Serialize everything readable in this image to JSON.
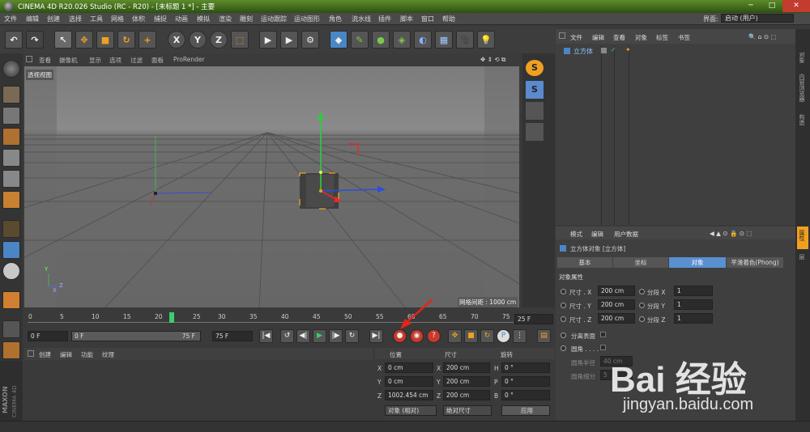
{
  "window": {
    "title": "CINEMA 4D R20.026 Studio (RC - R20) - [未标题 1 *] - 主要",
    "minimize": "─",
    "maximize": "□",
    "close": "✕"
  },
  "menu": [
    "文件",
    "编辑",
    "创建",
    "选择",
    "工具",
    "网格",
    "体积",
    "捕捉",
    "动画",
    "模拟",
    "渲染",
    "雕刻",
    "运动跟踪",
    "运动图形",
    "角色",
    "流水线",
    "插件",
    "脚本",
    "窗口",
    "帮助"
  ],
  "layout": {
    "label": "界面:",
    "value": "启动 (用户)"
  },
  "toolbar": {
    "x": "X",
    "y": "Y",
    "z": "Z",
    "undo_icon": "undo-icon"
  },
  "viewport": {
    "menu": [
      "查看",
      "摄像机",
      "显示",
      "选项",
      "过滤",
      "面板",
      "ProRender"
    ],
    "label": "透视视图",
    "grid_spacing": "网格间距 : 1000 cm",
    "axis_y": "Y",
    "axis_z": "Z",
    "axis_x": "X"
  },
  "timeline": {
    "ticks": [
      "0",
      "5",
      "10",
      "15",
      "20",
      "25",
      "30",
      "35",
      "40",
      "45",
      "50",
      "55",
      "60",
      "65",
      "70",
      "75"
    ],
    "current_frame": 22,
    "end_label": "25 F"
  },
  "playback": {
    "start": "0 F",
    "range_start": "0 F",
    "range_end": "75 F",
    "end": "75 F"
  },
  "material": {
    "menu": [
      "创建",
      "编辑",
      "功能",
      "纹理"
    ]
  },
  "coords": {
    "headers": [
      "位置",
      "尺寸",
      "旋转"
    ],
    "rows": [
      {
        "axis": "X",
        "pos": "0 cm",
        "saxis": "X",
        "size": "200 cm",
        "raxis": "H",
        "rot": "0 °"
      },
      {
        "axis": "Y",
        "pos": "0 cm",
        "saxis": "Y",
        "size": "200 cm",
        "raxis": "P",
        "rot": "0 °"
      },
      {
        "axis": "Z",
        "pos": "1002.454 cm",
        "saxis": "Z",
        "size": "200 cm",
        "raxis": "B",
        "rot": "0 °"
      }
    ],
    "mode": "对象 (相对)",
    "size_mode": "绝对尺寸",
    "apply": "应用"
  },
  "objects": {
    "menu": [
      "文件",
      "编辑",
      "查看",
      "对象",
      "标签",
      "书签"
    ],
    "items": [
      {
        "name": "立方体"
      }
    ]
  },
  "attributes": {
    "menu": [
      "模式",
      "编辑",
      "用户数据"
    ],
    "title": "立方体对象 [立方体]",
    "tabs": [
      "基本",
      "坐标",
      "对象",
      "平滑着色(Phong)"
    ],
    "section": "对象属性",
    "props": [
      {
        "label": "尺寸 . X",
        "value": "200 cm",
        "seg_label": "分段 X",
        "seg": "1"
      },
      {
        "label": "尺寸 . Y",
        "value": "200 cm",
        "seg_label": "分段 Y",
        "seg": "1"
      },
      {
        "label": "尺寸 . Z",
        "value": "200 cm",
        "seg_label": "分段 Z",
        "seg": "1"
      }
    ],
    "separate": "分离表面",
    "fillet": "圆角 . . . .",
    "fillet_radius_label": "圆角半径",
    "fillet_radius": "40 cm",
    "fillet_sub_label": "圆角细分",
    "fillet_sub": "5"
  },
  "side_tabs": [
    "对象",
    "内容浏览器",
    "构造",
    "属性",
    "层"
  ],
  "brand": {
    "maxon": "MAXON",
    "c4d": "CINEMA 4D"
  },
  "watermark": {
    "text": "Bai 经验",
    "url": "jingyan.baidu.com"
  },
  "colors": {
    "accent": "#4a86c5",
    "title_green": "#4f7c24",
    "tab_active": "#5a8fd0"
  }
}
